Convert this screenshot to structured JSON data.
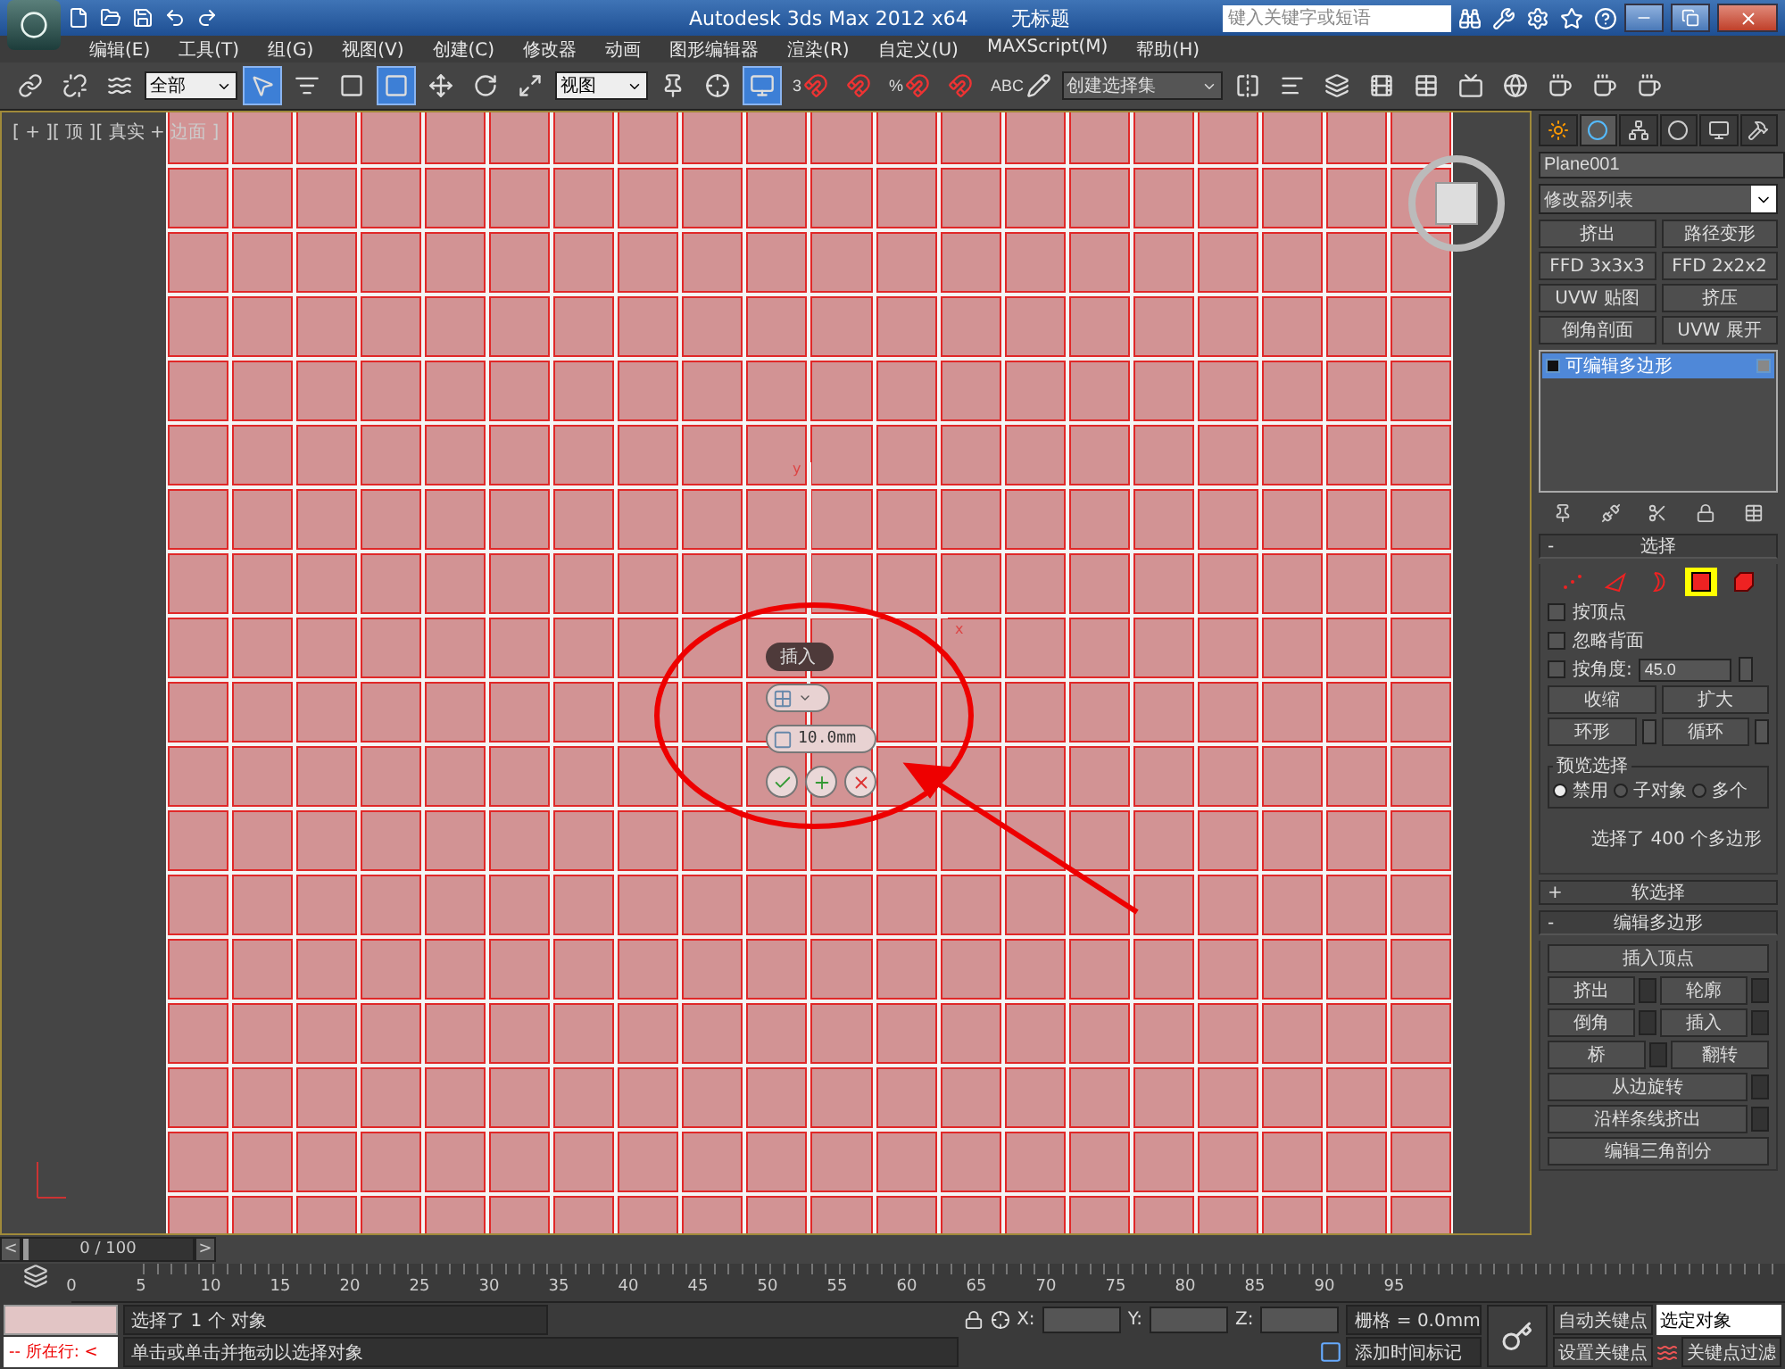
{
  "window": {
    "title": "Autodesk 3ds Max  2012 x64",
    "document": "无标题",
    "search_placeholder": "键入关键字或短语"
  },
  "menu": [
    "编辑(E)",
    "工具(T)",
    "组(G)",
    "视图(V)",
    "创建(C)",
    "修改器",
    "动画",
    "图形编辑器",
    "渲染(R)",
    "自定义(U)",
    "MAXScript(M)",
    "帮助(H)"
  ],
  "toolbar": [
    {
      "kind": "button",
      "selected": false
    },
    {
      "kind": "button",
      "selected": false
    },
    {
      "kind": "button",
      "selected": false
    },
    {
      "kind": "dropdown",
      "value": "全部"
    },
    {
      "kind": "button",
      "selected": true
    },
    {
      "kind": "button",
      "selected": false
    },
    {
      "kind": "button",
      "selected": false
    },
    {
      "kind": "button",
      "selected": true
    },
    {
      "kind": "button",
      "selected": false
    },
    {
      "kind": "button",
      "selected": false
    },
    {
      "kind": "button",
      "selected": false
    },
    {
      "kind": "dropdown",
      "value": "视图"
    },
    {
      "kind": "button",
      "selected": false
    },
    {
      "kind": "button",
      "selected": false
    },
    {
      "kind": "button",
      "selected": true
    },
    {
      "kind": "button",
      "selected": false,
      "label": "3"
    },
    {
      "kind": "button",
      "selected": false
    },
    {
      "kind": "button",
      "selected": false,
      "label": "%"
    },
    {
      "kind": "button",
      "selected": false
    },
    {
      "kind": "button",
      "selected": false,
      "label": "ABC"
    },
    {
      "kind": "dropdown",
      "value": "创建选择集"
    },
    {
      "kind": "button",
      "selected": false
    },
    {
      "kind": "button",
      "selected": false
    },
    {
      "kind": "button",
      "selected": false
    },
    {
      "kind": "button",
      "selected": false
    },
    {
      "kind": "button",
      "selected": false
    },
    {
      "kind": "button",
      "selected": false
    },
    {
      "kind": "button",
      "selected": false
    },
    {
      "kind": "button",
      "selected": false
    },
    {
      "kind": "button",
      "selected": false
    },
    {
      "kind": "button",
      "selected": false
    }
  ],
  "viewport": {
    "label": "[ + ][ 顶 ][ 真实 + 边面 ]",
    "gizmo": {
      "x_label": "x",
      "y_label": "y"
    },
    "caddy": {
      "title": "插入",
      "value": "10.0mm"
    }
  },
  "command_panel": {
    "tabs": [
      {
        "selected": false
      },
      {
        "selected": true
      },
      {
        "selected": false
      },
      {
        "selected": false
      },
      {
        "selected": false
      },
      {
        "selected": false
      }
    ],
    "object_name": "Plane001",
    "modifier_list": "修改器列表",
    "modifier_buttons": [
      "挤出",
      "路径变形",
      "FFD 3x3x3",
      "FFD 2x2x2",
      "UVW 贴图",
      "挤压",
      "倒角剖面",
      "UVW 展开"
    ],
    "stack": [
      {
        "label": "可编辑多边形",
        "selected": true
      }
    ],
    "rollouts": [
      {
        "title": "选择",
        "toggle": "-",
        "expanded": true,
        "kind": "selection",
        "subobjects": [
          {
            "selected": false
          },
          {
            "selected": false
          },
          {
            "selected": false
          },
          {
            "selected": true
          },
          {
            "selected": false
          }
        ],
        "checks": [
          {
            "label": "按顶点",
            "checked": false
          },
          {
            "label": "忽略背面",
            "checked": false
          },
          {
            "label": "按角度:",
            "checked": false,
            "value": "45.0"
          }
        ],
        "buttons": [
          "收缩",
          "扩大"
        ],
        "spin_buttons": [
          "环形",
          "循环"
        ],
        "preview": {
          "title": "预览选择",
          "options": [
            {
              "label": "禁用",
              "selected": true
            },
            {
              "label": "子对象",
              "selected": false
            },
            {
              "label": "多个",
              "selected": false
            }
          ]
        },
        "status": "选择了 400 个多边形"
      },
      {
        "title": "软选择",
        "toggle": "+",
        "expanded": false
      },
      {
        "title": "编辑多边形",
        "toggle": "-",
        "expanded": true,
        "kind": "edit",
        "rows": [
          [
            {
              "label": "插入顶点",
              "settings": false
            }
          ],
          [
            {
              "label": "挤出",
              "settings": true
            },
            {
              "label": "轮廓",
              "settings": true
            }
          ],
          [
            {
              "label": "倒角",
              "settings": true
            },
            {
              "label": "插入",
              "settings": true
            }
          ],
          [
            {
              "label": "桥",
              "settings": true
            },
            {
              "label": "翻转",
              "settings": false
            }
          ],
          [
            {
              "label": "从边旋转",
              "settings": true
            }
          ],
          [
            {
              "label": "沿样条线挤出",
              "settings": true
            }
          ],
          [
            {
              "label": "编辑三角剖分",
              "settings": false
            }
          ]
        ]
      }
    ]
  },
  "time_slider": {
    "frame": "0 / 100",
    "prev": "<",
    "next": ">",
    "level": 0
  },
  "track_ticks": [
    "0",
    "5",
    "10",
    "15",
    "20",
    "25",
    "30",
    "35",
    "40",
    "45",
    "50",
    "55",
    "60",
    "65",
    "70",
    "75",
    "80",
    "85",
    "90",
    "95"
  ],
  "status_bar": {
    "listener": "--  所在行:  <",
    "selection": "选择了 1 个 对象",
    "prompt": "单击或单击并拖动以选择对象",
    "x": "X:",
    "y": "Y:",
    "z": "Z:",
    "grid": "栅格 = 0.0mm",
    "time_tag": "添加时间标记",
    "auto_key": "自动关键点",
    "set_key": "设置关键点",
    "key_mode": "选定对象",
    "key_filters": "关键点过滤"
  }
}
